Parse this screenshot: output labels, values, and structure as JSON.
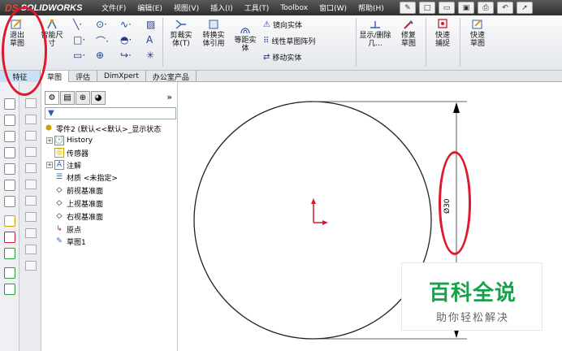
{
  "app": {
    "logo": "SOLIDWORKS",
    "logo_mark": "DS"
  },
  "menu": [
    "文件(F)",
    "编辑(E)",
    "视图(V)",
    "插入(I)",
    "工具(T)",
    "Toolbox",
    "窗口(W)",
    "帮助(H)"
  ],
  "ribbon": {
    "exit_sketch": "退出草图",
    "smart_dim": "智能尺寸",
    "trim": "剪裁实体(T)",
    "convert": "转换实体引用",
    "offset": "等距实体",
    "mirror": "镜向实体",
    "linear_pattern": "线性草图阵列",
    "move": "移动实体",
    "display_delete": "显示/删除几...",
    "repair": "修复草图",
    "quick_snap": "快速捕捉",
    "rapid_sketch": "快速草图"
  },
  "tabs": [
    "特征",
    "草图",
    "评估",
    "DimXpert",
    "办公室产品"
  ],
  "tree": {
    "root": "零件2 (默认<<默认>_显示状态",
    "items": [
      {
        "label": "History",
        "icon": "history-icon",
        "expander": "+"
      },
      {
        "label": "传感器",
        "icon": "sensor-icon",
        "expander": ""
      },
      {
        "label": "注解",
        "icon": "annotation-icon",
        "expander": "+"
      },
      {
        "label": "材质 <未指定>",
        "icon": "material-icon",
        "expander": ""
      },
      {
        "label": "前视基准面",
        "icon": "plane-icon",
        "expander": ""
      },
      {
        "label": "上视基准面",
        "icon": "plane-icon",
        "expander": ""
      },
      {
        "label": "右视基准面",
        "icon": "plane-icon",
        "expander": ""
      },
      {
        "label": "原点",
        "icon": "origin-icon",
        "expander": ""
      },
      {
        "label": "草图1",
        "icon": "sketch-icon",
        "expander": ""
      }
    ]
  },
  "dimension": {
    "text": "Ø30"
  },
  "watermark": {
    "title": "百科全说",
    "subtitle": "助你轻松解决"
  },
  "colors": {
    "highlight": "#e0182d",
    "origin": "#d21a2a",
    "watermark": "#1aa04b"
  }
}
